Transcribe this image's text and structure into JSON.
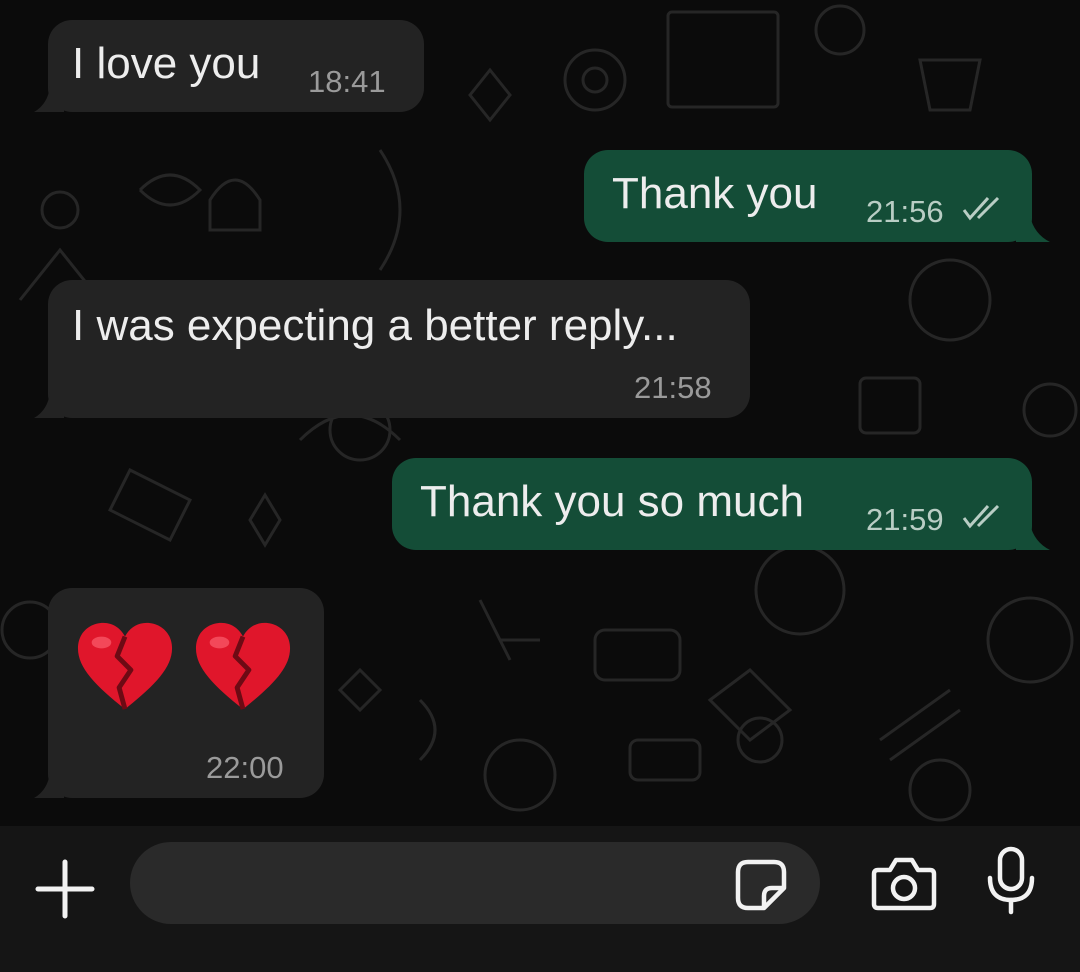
{
  "messages": [
    {
      "direction": "in",
      "text": "I love you",
      "time": "18:41"
    },
    {
      "direction": "out",
      "text": "Thank you",
      "time": "21:56",
      "status": "read"
    },
    {
      "direction": "in",
      "text": "I was expecting a better reply...",
      "time": "21:58"
    },
    {
      "direction": "out",
      "text": "Thank you so much",
      "time": "21:59",
      "status": "read"
    },
    {
      "direction": "in",
      "emoji": [
        "broken-heart",
        "broken-heart"
      ],
      "time": "22:00"
    }
  ],
  "composer": {
    "input_value": "",
    "icons": [
      "plus-icon",
      "sticker-icon",
      "camera-icon",
      "microphone-icon"
    ]
  },
  "colors": {
    "background": "#0b0b0b",
    "incoming_bubble": "#232323",
    "outgoing_bubble": "#144d37",
    "heart": "#e0162b"
  }
}
